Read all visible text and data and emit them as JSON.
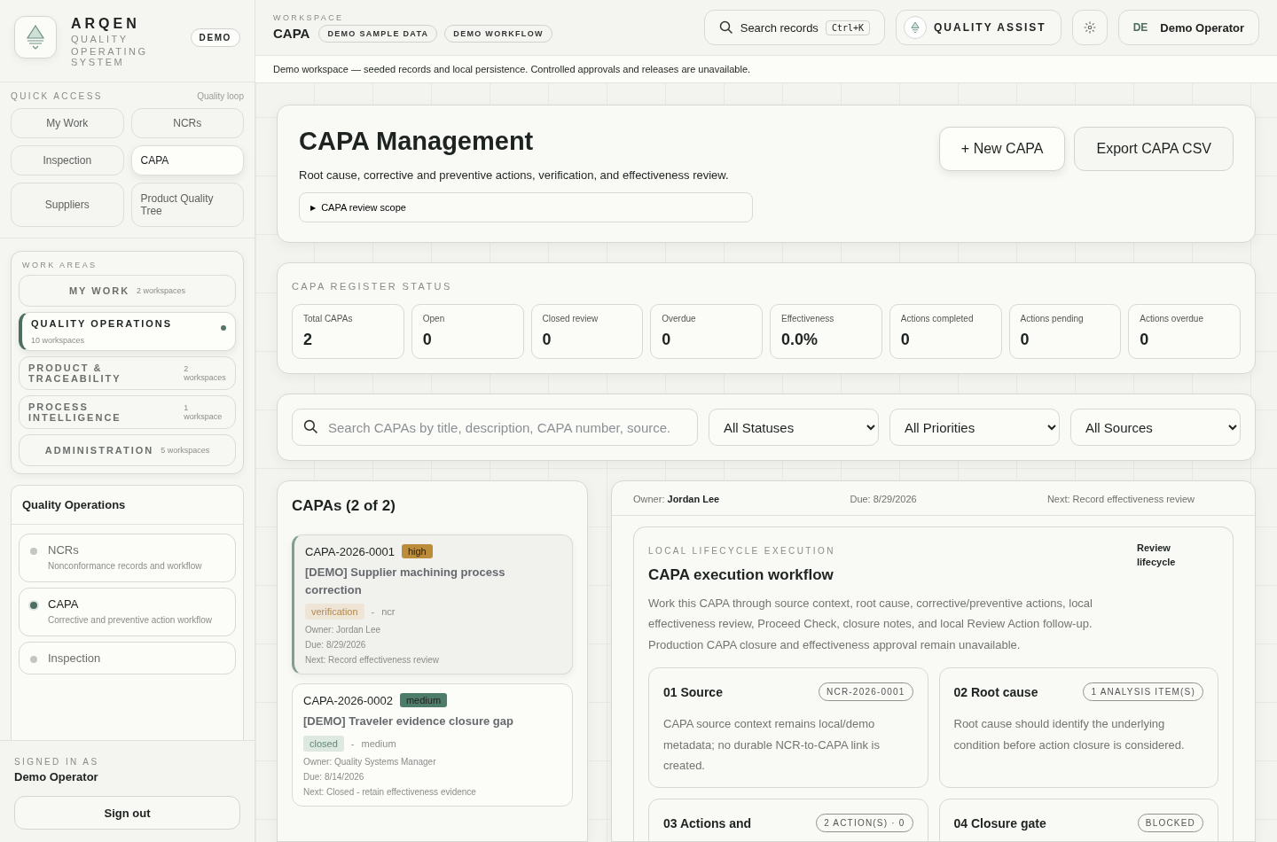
{
  "brand": {
    "name": "ARQEN",
    "line1": "QUALITY",
    "line2": "OPERATING SYSTEM",
    "badge": "DEMO"
  },
  "quick_access": {
    "title": "QUICK ACCESS",
    "hint": "Quality loop",
    "items": [
      {
        "label": "My Work",
        "selected": false
      },
      {
        "label": "NCRs",
        "selected": false
      },
      {
        "label": "Inspection",
        "selected": false
      },
      {
        "label": "CAPA",
        "selected": true
      },
      {
        "label": "Suppliers",
        "selected": false
      },
      {
        "label": "Product Quality Tree",
        "selected": false
      }
    ]
  },
  "work_areas": {
    "title": "WORK AREAS",
    "items": [
      {
        "label": "MY WORK",
        "count": "2 workspaces",
        "selected": false
      },
      {
        "label": "QUALITY OPERATIONS",
        "count": "10 workspaces",
        "selected": true
      },
      {
        "label": "PRODUCT & TRACEABILITY",
        "count": "2 workspaces",
        "selected": false
      },
      {
        "label": "PROCESS INTELLIGENCE",
        "count": "1 workspace",
        "selected": false
      },
      {
        "label": "ADMINISTRATION",
        "count": "5 workspaces",
        "selected": false
      }
    ]
  },
  "section": {
    "title": "Quality Operations",
    "items": [
      {
        "label": "NCRs",
        "description": "Nonconformance records and workflow",
        "selected": false
      },
      {
        "label": "CAPA",
        "description": "Corrective and preventive action workflow",
        "selected": true
      },
      {
        "label": "Inspection",
        "selected": false
      }
    ]
  },
  "user": {
    "caption": "SIGNED IN AS",
    "name": "Demo Operator",
    "sign_out": "Sign out"
  },
  "topbar": {
    "caption": "WORKSPACE",
    "title": "CAPA",
    "tags": [
      "DEMO SAMPLE DATA",
      "DEMO WORKFLOW"
    ],
    "search": "Search records",
    "shortcut": "Ctrl+K",
    "assist": "QUALITY ASSIST",
    "initials": "DE",
    "user": "Demo Operator"
  },
  "banner": "Demo workspace — seeded records and local persistence. Controlled approvals and releases are unavailable.",
  "header": {
    "title": "CAPA Management",
    "subtitle": "Root cause, corrective and preventive actions, verification, and effectiveness review.",
    "scope": "CAPA review scope",
    "scope_icon": "▶",
    "scope_expanded": false,
    "buttons": [
      "+ New CAPA",
      "Export CAPA CSV"
    ]
  },
  "register": {
    "title": "CAPA REGISTER STATUS",
    "stats": [
      {
        "label": "Total CAPAs",
        "value": "2"
      },
      {
        "label": "Open",
        "value": "0"
      },
      {
        "label": "Closed review",
        "value": "0"
      },
      {
        "label": "Overdue",
        "value": "0"
      },
      {
        "label": "Effectiveness",
        "value": "0.0%"
      },
      {
        "label": "Actions completed",
        "value": "0"
      },
      {
        "label": "Actions pending",
        "value": "0"
      },
      {
        "label": "Actions overdue",
        "value": "0"
      }
    ]
  },
  "filters": {
    "search_placeholder": "Search CAPAs by title, description, CAPA number, source.",
    "selects": [
      "All Statuses",
      "All Priorities",
      "All Sources"
    ]
  },
  "list": {
    "title": "CAPAs (2 of 2)",
    "items": [
      {
        "number": "CAPA-2026-0001",
        "priority": "high",
        "title": "[DEMO] Supplier machining process correction",
        "status": "verification",
        "separator": "-",
        "source": "ncr",
        "owner": "Owner: Jordan Lee",
        "due": "Due: 8/29/2026",
        "next": "Next: Record effectiveness review",
        "selected": true
      },
      {
        "number": "CAPA-2026-0002",
        "priority": "medium",
        "title": "[DEMO] Traveler evidence closure gap",
        "status": "closed",
        "separator": "-",
        "source": "medium",
        "owner": "Owner: Quality Systems Manager",
        "due": "Due: 8/14/2026",
        "next": "Next: Closed - retain effectiveness evidence",
        "selected": false
      }
    ]
  },
  "detail": {
    "owner_label": "Owner:",
    "owner": "Jordan Lee",
    "due": "Due: 8/29/2026",
    "next": "Next: Record effectiveness review",
    "workflow": {
      "caption": "LOCAL LIFECYCLE EXECUTION",
      "title": "CAPA execution workflow",
      "link": "Review lifecycle",
      "text": "Work this CAPA through source context, root cause, corrective/preventive actions, local effectiveness review, Proceed Check, closure notes, and local Review Action follow-up. Production CAPA closure and effectiveness approval remain unavailable.",
      "steps": [
        {
          "title": "01 Source",
          "badge": "NCR-2026-0001",
          "text": "CAPA source context remains local/demo metadata; no durable NCR-to-CAPA link is created."
        },
        {
          "title": "02 Root cause",
          "badge": "1 ANALYSIS ITEM(S)",
          "text": "Root cause should identify the underlying condition before action closure is considered."
        },
        {
          "title": "03 Actions and",
          "badge": "2 ACTION(S) · 0"
        },
        {
          "title": "04 Closure gate",
          "badge": "BLOCKED"
        }
      ]
    }
  }
}
